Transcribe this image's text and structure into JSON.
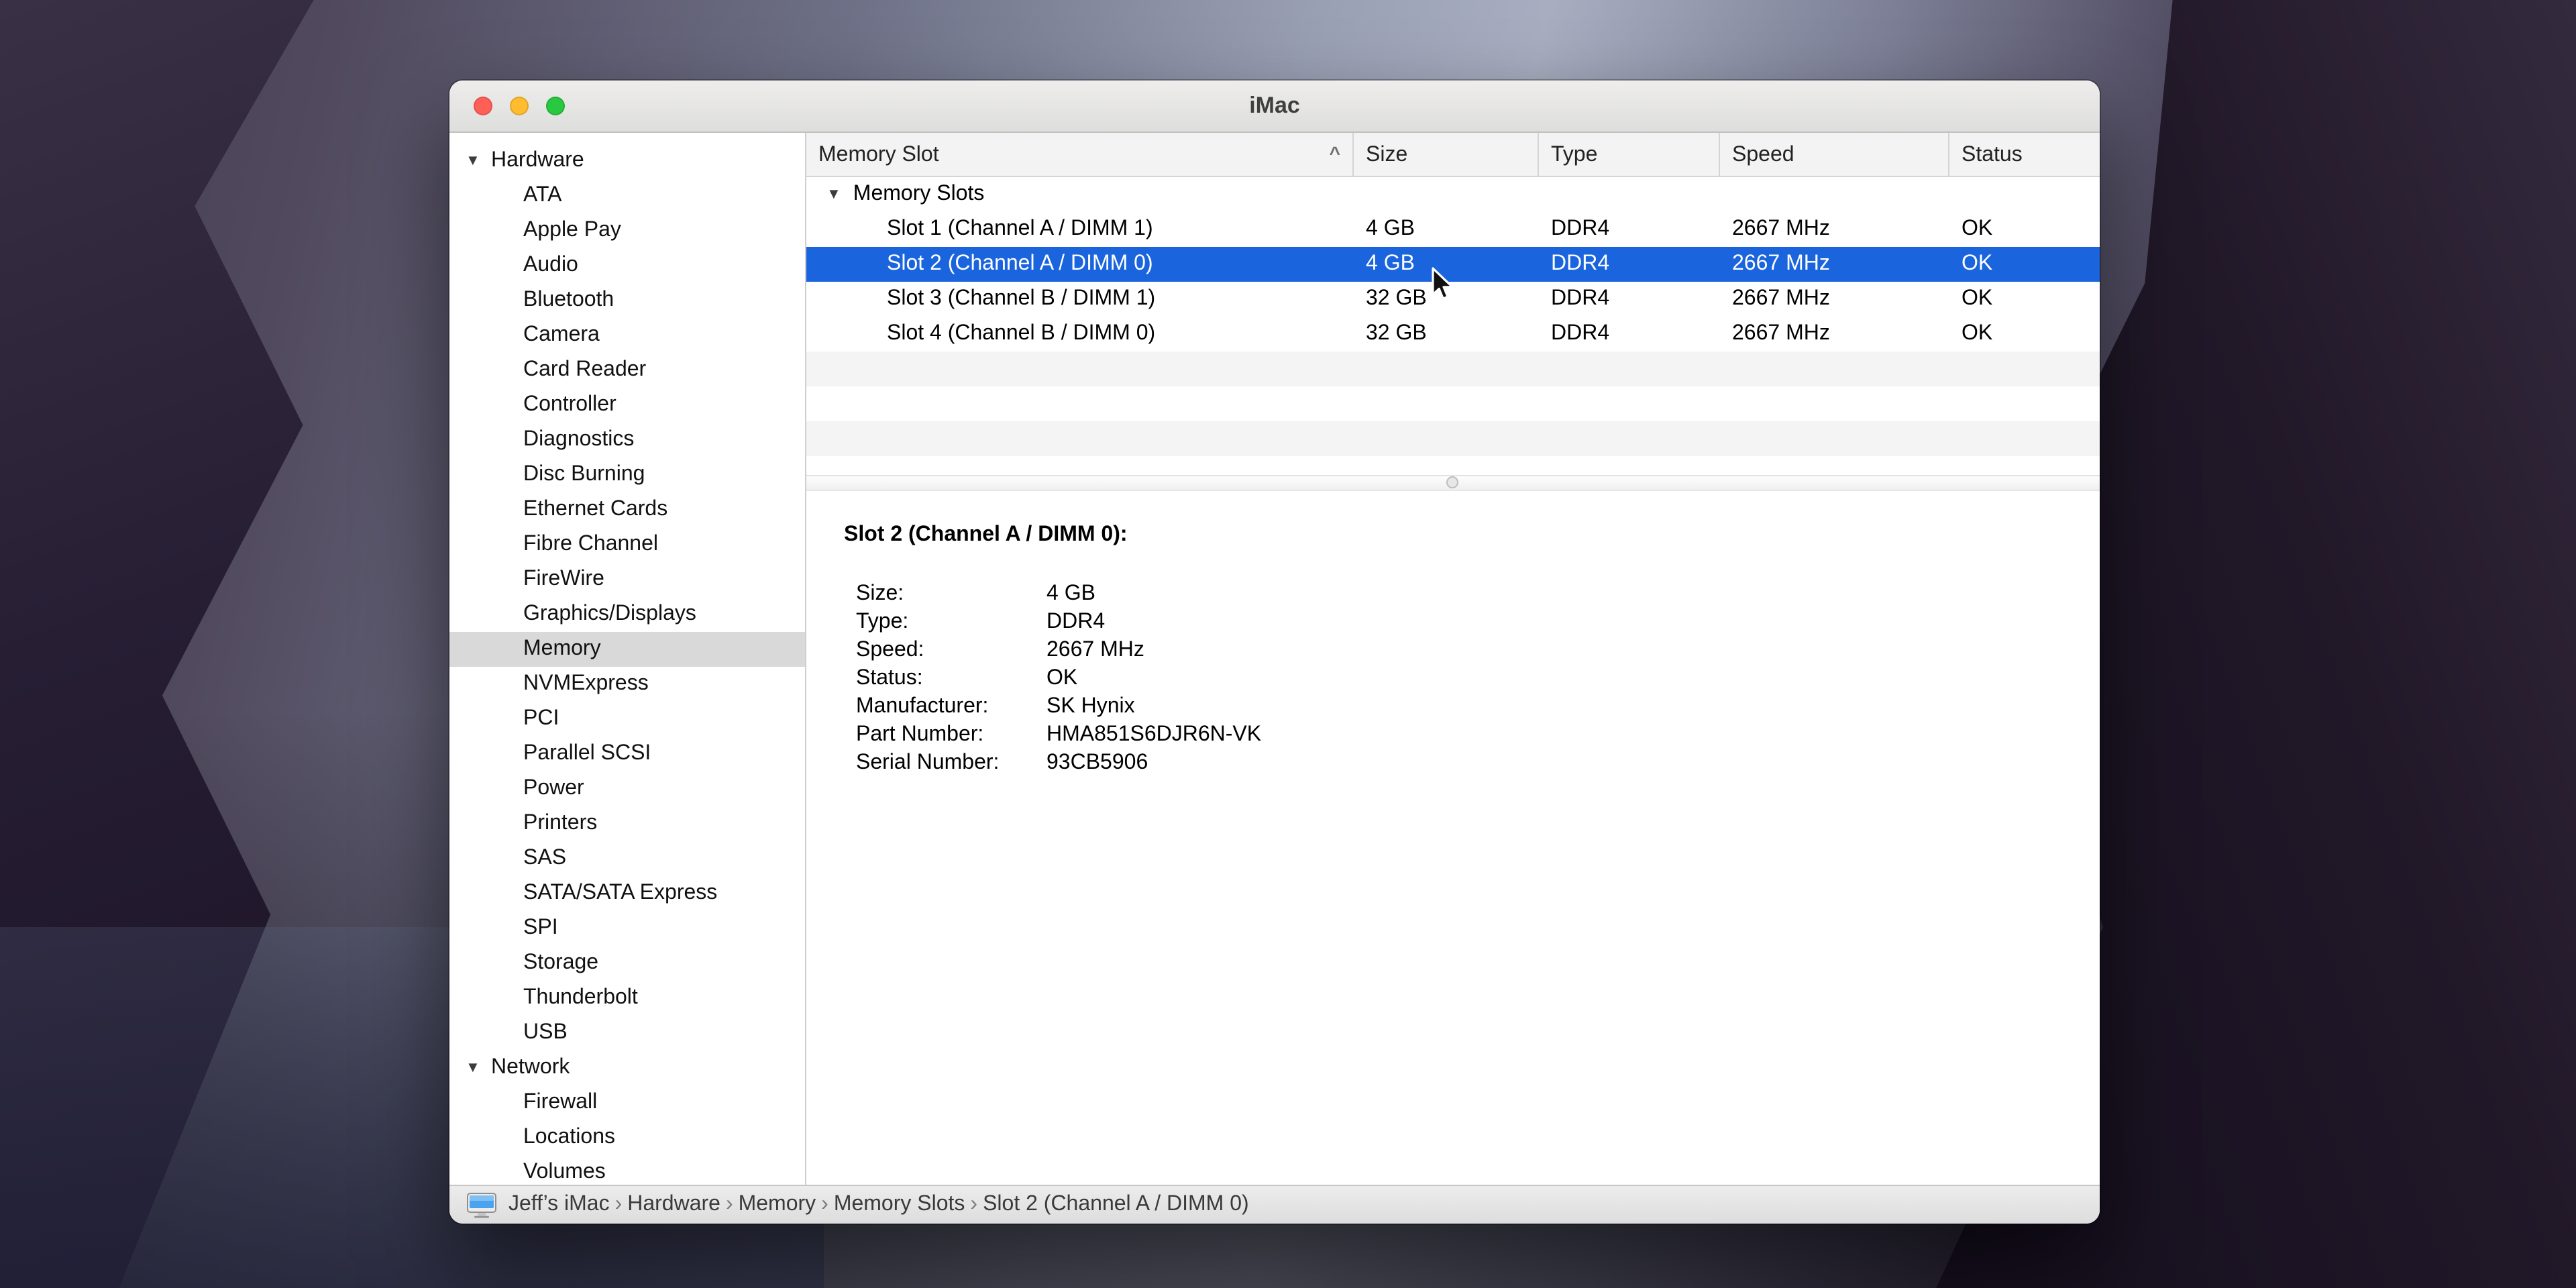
{
  "window": {
    "title": "iMac"
  },
  "colors": {
    "selection_blue": "#1a64dd",
    "sidebar_selected_gray": "#d9d9d9",
    "traffic_red": "#ff5f57",
    "traffic_yellow": "#febc2e",
    "traffic_green": "#28c840"
  },
  "icons": {
    "disclosure_open": "▼",
    "sort_asc": "^",
    "computer": "imac-display"
  },
  "sidebar": {
    "sections": [
      {
        "label": "Hardware",
        "expanded": true,
        "selected": "Memory",
        "items": [
          "ATA",
          "Apple Pay",
          "Audio",
          "Bluetooth",
          "Camera",
          "Card Reader",
          "Controller",
          "Diagnostics",
          "Disc Burning",
          "Ethernet Cards",
          "Fibre Channel",
          "FireWire",
          "Graphics/Displays",
          "Memory",
          "NVMExpress",
          "PCI",
          "Parallel SCSI",
          "Power",
          "Printers",
          "SAS",
          "SATA/SATA Express",
          "SPI",
          "Storage",
          "Thunderbolt",
          "USB"
        ]
      },
      {
        "label": "Network",
        "expanded": true,
        "selected": "",
        "items": [
          "Firewall",
          "Locations",
          "Volumes"
        ]
      }
    ]
  },
  "table": {
    "columns": [
      {
        "label": "Memory Slot",
        "sort": "asc"
      },
      {
        "label": "Size"
      },
      {
        "label": "Type"
      },
      {
        "label": "Speed"
      },
      {
        "label": "Status"
      }
    ],
    "group": "Memory Slots",
    "rows": [
      {
        "slot": "Slot 1 (Channel A / DIMM 1)",
        "size": "4 GB",
        "type": "DDR4",
        "speed": "2667 MHz",
        "status": "OK",
        "selected": false
      },
      {
        "slot": "Slot 2 (Channel A / DIMM 0)",
        "size": "4 GB",
        "type": "DDR4",
        "speed": "2667 MHz",
        "status": "OK",
        "selected": true
      },
      {
        "slot": "Slot 3 (Channel B / DIMM 1)",
        "size": "32 GB",
        "type": "DDR4",
        "speed": "2667 MHz",
        "status": "OK",
        "selected": false
      },
      {
        "slot": "Slot 4 (Channel B / DIMM 0)",
        "size": "32 GB",
        "type": "DDR4",
        "speed": "2667 MHz",
        "status": "OK",
        "selected": false
      }
    ]
  },
  "detail": {
    "title": "Slot 2 (Channel A / DIMM 0):",
    "fields": [
      {
        "label": "Size:",
        "value": "4 GB"
      },
      {
        "label": "Type:",
        "value": "DDR4"
      },
      {
        "label": "Speed:",
        "value": "2667 MHz"
      },
      {
        "label": "Status:",
        "value": "OK"
      },
      {
        "label": "Manufacturer:",
        "value": "SK Hynix"
      },
      {
        "label": "Part Number:",
        "value": "HMA851S6DJR6N-VK"
      },
      {
        "label": "Serial Number:",
        "value": "93CB5906"
      }
    ]
  },
  "statusbar": {
    "separator": "›",
    "path": [
      "Jeff’s iMac",
      "Hardware",
      "Memory",
      "Memory Slots",
      "Slot 2 (Channel A / DIMM 0)"
    ]
  }
}
